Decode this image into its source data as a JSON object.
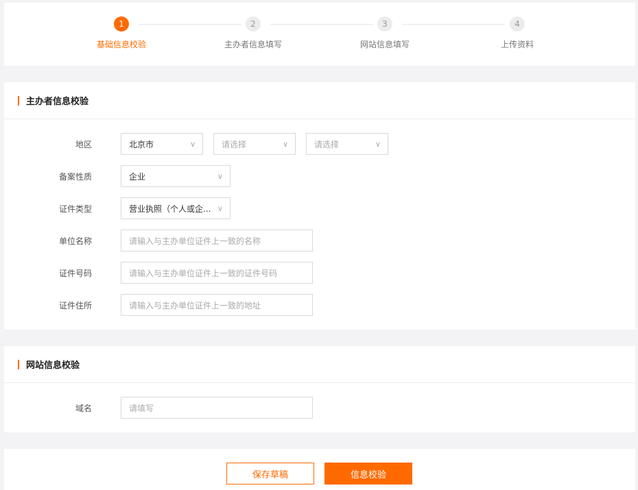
{
  "steps": [
    {
      "num": "1",
      "label": "基础信息校验"
    },
    {
      "num": "2",
      "label": "主办者信息填写"
    },
    {
      "num": "3",
      "label": "网站信息填写"
    },
    {
      "num": "4",
      "label": "上传资料"
    }
  ],
  "sponsor": {
    "title": "主办者信息校验",
    "region_label": "地区",
    "region": [
      "北京市",
      "请选择",
      "请选择"
    ],
    "nature_label": "备案性质",
    "nature": "企业",
    "cert_type_label": "证件类型",
    "cert_type": "营业执照（个人或企...",
    "unit_label": "单位名称",
    "unit_ph": "请输入与主办单位证件上一致的名称",
    "cert_no_label": "证件号码",
    "cert_no_ph": "请输入与主办单位证件上一致的证件号码",
    "addr_label": "证件住所",
    "addr_ph": "请输入与主办单位证件上一致的地址"
  },
  "site": {
    "title": "网站信息校验",
    "domain_label": "域名",
    "domain_ph": "请填写"
  },
  "buttons": {
    "save": "保存草稿",
    "verify": "信息校验"
  },
  "colors": {
    "accent": "#ff6a00"
  }
}
